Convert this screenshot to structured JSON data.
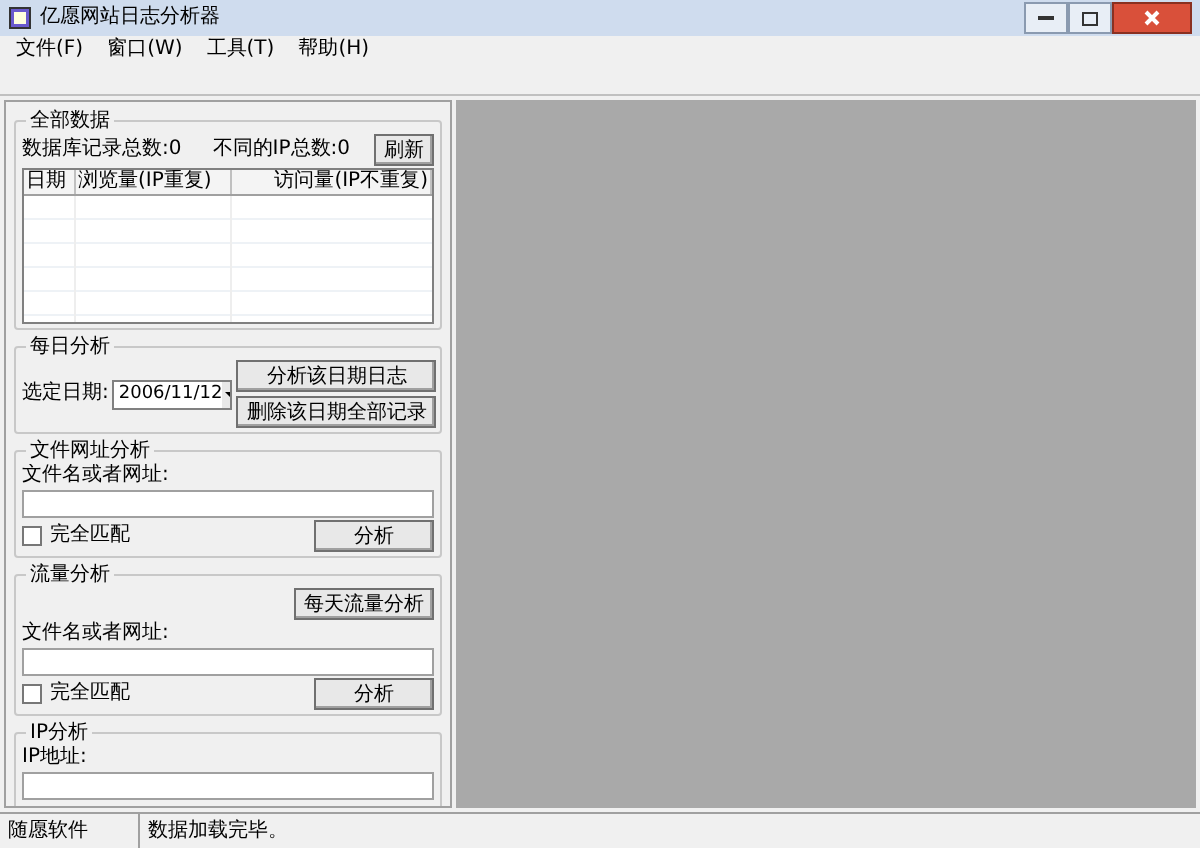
{
  "window": {
    "title": "亿愿网站日志分析器"
  },
  "menu": [
    "文件(F)",
    "窗口(W)",
    "工具(T)",
    "帮助(H)"
  ],
  "all_data": {
    "title": "全部数据",
    "record_total": "数据库记录总数:0",
    "ip_total": "不同的IP总数:0",
    "refresh_button": "刷新",
    "table": {
      "columns": [
        "日期",
        "浏览量(IP重复)",
        "访问量(IP不重复)"
      ]
    }
  },
  "daily": {
    "title": "每日分析",
    "date_label": "选定日期:",
    "date_value": "2006/11/12",
    "buttons": [
      "分析该日期日志",
      "删除该日期全部记录"
    ]
  },
  "file_url": {
    "title": "文件网址分析",
    "field_label": "文件名或者网址:",
    "exact_match": {
      "label": "完全匹配",
      "checked": false
    },
    "button": "分析"
  },
  "traffic": {
    "title": "流量分析",
    "daily_button": "每天流量分析",
    "field_label": "文件名或者网址:",
    "exact_match": {
      "label": "完全匹配",
      "checked": false
    },
    "button": "分析"
  },
  "ip": {
    "title": "IP分析",
    "field_label": "IP地址:"
  },
  "status_bar": [
    "随愿软件",
    "数据加载完毕。"
  ]
}
